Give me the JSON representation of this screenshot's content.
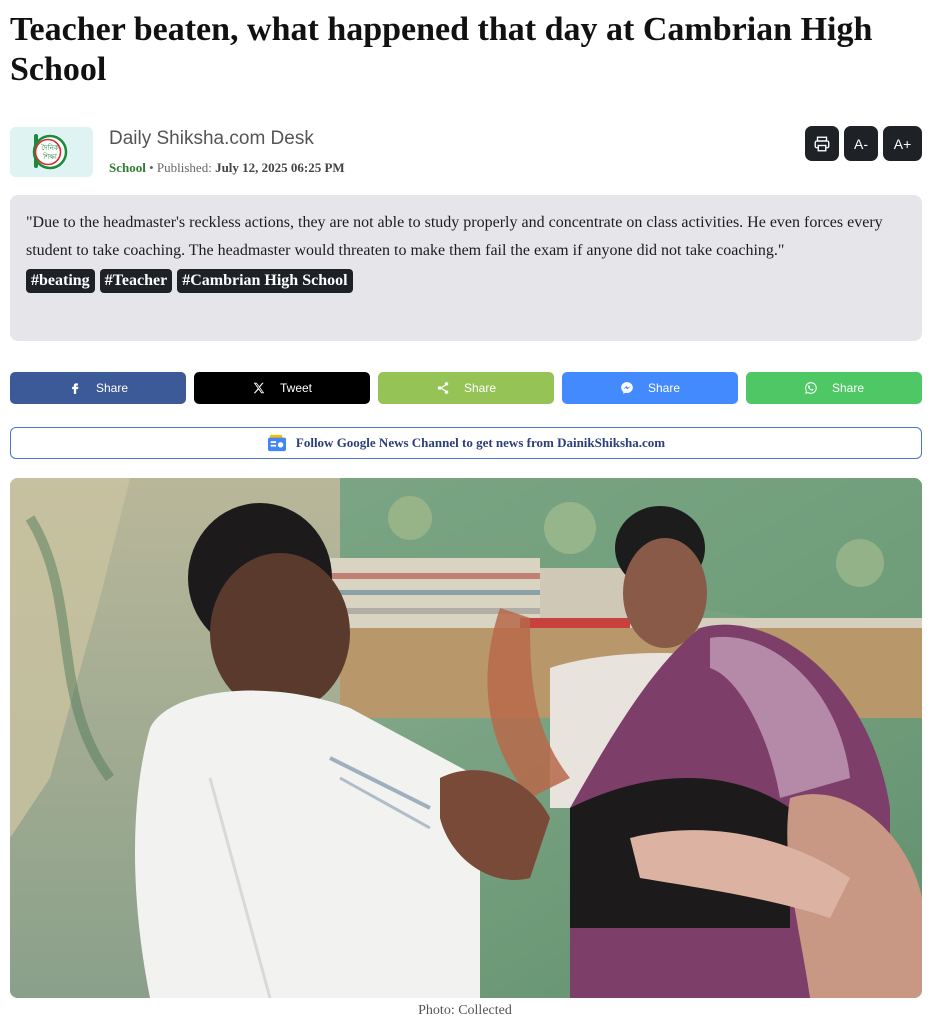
{
  "article": {
    "headline": "Teacher beaten, what happened that day at Cambrian High School",
    "author": "Daily Shiksha.com Desk",
    "category": "School",
    "published_label": "Published:",
    "published_date": "July 12, 2025 06:25 PM",
    "logo_text_line1": "দৈনিক",
    "logo_text_line2": "শিক্ষা",
    "summary": "\"Due to the headmaster's reckless actions, they are not able to study properly and concentrate on class activities. He even forces every student to take coaching. The headmaster would threaten to make them fail the exam if anyone did not take coaching.\"",
    "tags": [
      "#beating",
      "#Teacher",
      "#Cambrian High School"
    ],
    "photo_caption": "Photo: Collected"
  },
  "tools": {
    "print_icon": "printer-icon",
    "font_decrease": "A-",
    "font_increase": "A+"
  },
  "share": [
    {
      "id": "facebook",
      "label": "Share",
      "icon": "facebook-icon",
      "color": "#3d5a98"
    },
    {
      "id": "twitter",
      "label": "Tweet",
      "icon": "x-icon",
      "color": "#000000"
    },
    {
      "id": "generic",
      "label": "Share",
      "icon": "share-icon",
      "color": "#95c356"
    },
    {
      "id": "messenger",
      "label": "Share",
      "icon": "messenger-icon",
      "color": "#448aff"
    },
    {
      "id": "whatsapp",
      "label": "Share",
      "icon": "whatsapp-icon",
      "color": "#4ec765"
    }
  ],
  "google_news": {
    "text": "Follow Google News Channel to get news from DainikShiksha.com",
    "icon": "google-news-icon"
  },
  "colors": {
    "dark_button": "#1e2227",
    "summary_bg": "#e6e6ea",
    "category": "#2e7d32",
    "gnews_border": "#4a78c7"
  }
}
